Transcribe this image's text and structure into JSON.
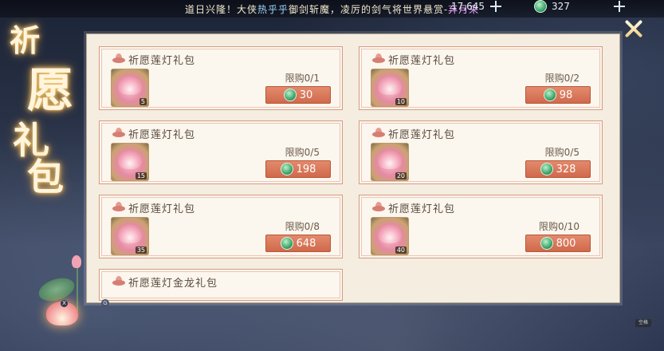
{
  "ticker": {
    "prefix": "道日兴隆！大侠",
    "player": "热乎乎",
    "middle": "御剑斩魔，凌厉的剑气将世界悬赏-",
    "target": "弃月来"
  },
  "currency": [
    {
      "icon": "jade-coin-icon",
      "value": "17,645"
    },
    {
      "icon": "jade-coin-icon",
      "value": "327"
    }
  ],
  "side_title": [
    "祈",
    "愿",
    "礼",
    "包"
  ],
  "packs": [
    {
      "title": "祈愿莲灯礼包",
      "limit": "限购0/1",
      "price": "30",
      "count": "5"
    },
    {
      "title": "祈愿莲灯礼包",
      "limit": "限购0/2",
      "price": "98",
      "count": "10"
    },
    {
      "title": "祈愿莲灯礼包",
      "limit": "限购0/5",
      "price": "198",
      "count": "15"
    },
    {
      "title": "祈愿莲灯礼包",
      "limit": "限购0/5",
      "price": "328",
      "count": "20"
    },
    {
      "title": "祈愿莲灯礼包",
      "limit": "限购0/8",
      "price": "648",
      "count": "35"
    },
    {
      "title": "祈愿莲灯礼包",
      "limit": "限购0/10",
      "price": "800",
      "count": "40"
    },
    {
      "title": "祈愿莲灯金龙礼包"
    }
  ],
  "badges": {
    "g": "G",
    "x": "X",
    "corner": "空格"
  },
  "colors": {
    "price_button": "#d0694c",
    "card_border": "#d89a82",
    "panel_bg": "#f4ede0"
  }
}
